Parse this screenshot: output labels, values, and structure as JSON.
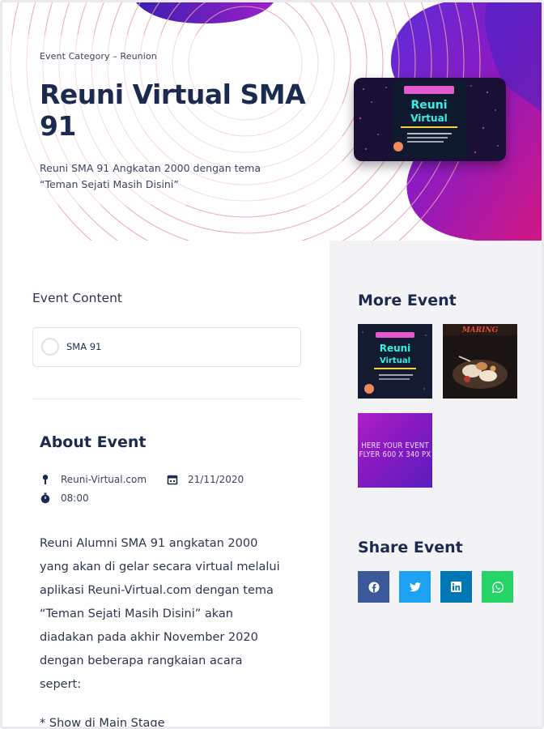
{
  "hero": {
    "category": "Event Category – Reunion",
    "title": "Reuni Virtual SMA 91",
    "description": "Reuni SMA 91 Angkatan 2000 dengan tema “Teman Sejati Masih Disini”",
    "thumbnail_alt": "Reuni Virtual"
  },
  "event_content": {
    "label": "Event Content",
    "items": [
      {
        "label": "SMA 91"
      }
    ]
  },
  "about": {
    "title": "About Event",
    "location": "Reuni-Virtual.com",
    "date": "21/11/2020",
    "time": "08:00",
    "body": "Reuni Alumni SMA 91 angkatan 2000 yang akan di gelar secara virtual melalui aplikasi Reuni-Virtual.com dengan tema “Teman Sejati Masih Disini” akan diadakan pada akhir November 2020 dengan beberapa rangkaian acara sepert:",
    "extra": "* Show di Main Stage"
  },
  "more_event": {
    "title": "More Event",
    "items": [
      {
        "type": "neon-poster"
      },
      {
        "type": "food-photo",
        "caption": "MARING"
      },
      {
        "type": "flyer",
        "text": "HERE YOUR EVENT FLYER 600 X 340 PX"
      }
    ]
  },
  "share": {
    "title": "Share Event",
    "buttons": [
      {
        "icon": "facebook-icon",
        "color": "#3b5998"
      },
      {
        "icon": "twitter-icon",
        "color": "#1da1f2"
      },
      {
        "icon": "linkedin-icon",
        "color": "#0077b5"
      },
      {
        "icon": "whatsapp-icon",
        "color": "#25d366"
      }
    ]
  }
}
